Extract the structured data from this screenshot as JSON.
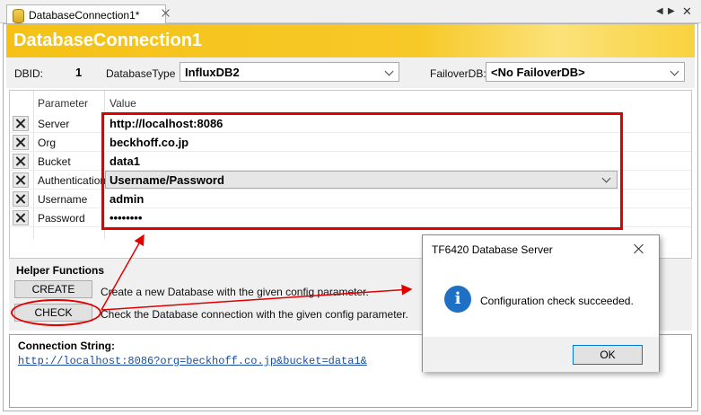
{
  "tab": {
    "title": "DatabaseConnection1*",
    "icon": "database-icon"
  },
  "header": {
    "title": "DatabaseConnection1"
  },
  "toprow": {
    "dbid_label": "DBID:",
    "dbid_value": "1",
    "dbtype_label": "DatabaseType",
    "dbtype_value": "InfluxDB2",
    "failover_label": "FailoverDB:",
    "failover_value": "<No FailoverDB>"
  },
  "grid": {
    "col_parameter": "Parameter",
    "col_value": "Value",
    "rows": [
      {
        "name": "Server",
        "value": "http://localhost:8086"
      },
      {
        "name": "Org",
        "value": "beckhoff.co.jp"
      },
      {
        "name": "Bucket",
        "value": "data1"
      },
      {
        "name": "Authentication",
        "value": "Username/Password"
      },
      {
        "name": "Username",
        "value": "admin"
      },
      {
        "name": "Password",
        "value": "••••••••"
      }
    ]
  },
  "helper": {
    "title": "Helper Functions",
    "create_label": "CREATE",
    "create_desc": "Create a new Database with the given config parameter.",
    "check_label": "CHECK",
    "check_desc": "Check the Database connection with the given config parameter."
  },
  "connection": {
    "title": "Connection String:",
    "value": "http://localhost:8086?org=beckhoff.co.jp&bucket=data1&"
  },
  "dialog": {
    "title": "TF6420 Database Server",
    "message": "Configuration check succeeded.",
    "ok_label": "OK",
    "icon": "info-icon"
  },
  "colors": {
    "header_yellow": "#f5c116",
    "annotation_red": "#e00000",
    "link_blue": "#1a4ea0",
    "info_blue": "#1f6fc5"
  }
}
